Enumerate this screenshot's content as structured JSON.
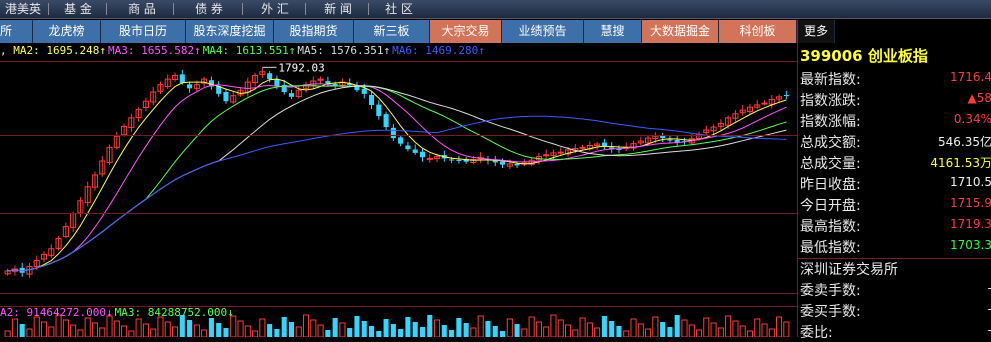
{
  "topbar": {
    "items": [
      "港美英",
      "基 金",
      "商 品",
      "债 券",
      "外 汇",
      "新 闻",
      "社 区"
    ]
  },
  "nav": {
    "tabs": [
      {
        "label": "所",
        "style": "blue"
      },
      {
        "label": "龙虎榜",
        "style": "blue"
      },
      {
        "label": "股市日历",
        "style": "blue"
      },
      {
        "label": "股东深度挖掘",
        "style": "blue"
      },
      {
        "label": "股指期货",
        "style": "blue"
      },
      {
        "label": "新三板",
        "style": "blue"
      },
      {
        "label": "大宗交易",
        "style": "hl"
      },
      {
        "label": "业绩预告",
        "style": "blue"
      },
      {
        "label": "慧搜",
        "style": "blue"
      },
      {
        "label": "大数据掘金",
        "style": "hl"
      },
      {
        "label": "科创板",
        "style": "hl"
      },
      {
        "label": "更多",
        "style": "dark"
      }
    ]
  },
  "ma_legend": [
    {
      "text": ", MA2: 1695.248↑",
      "color": "#ffff55"
    },
    {
      "text": "MA3: 1655.582↑",
      "color": "#ff55ff"
    },
    {
      "text": "MA4: 1613.551↑",
      "color": "#55ff55"
    },
    {
      "text": "MA5: 1576.351↑",
      "color": "#dddddd"
    },
    {
      "text": "MA6: 1469.280↑",
      "color": "#3b5bff"
    }
  ],
  "vol_legend": [
    {
      "text": "A2: 91464272.000↓",
      "color": "#ff55ff"
    },
    {
      "text": "MA3: 84288752.000↓",
      "color": "#55ff55"
    }
  ],
  "chart_data": {
    "type": "candlestick",
    "peak_label": "1792.03",
    "colors": {
      "up": "#ff3b3b",
      "down": "#33d6ff",
      "ma2": "#ffff55",
      "ma3": "#ff55ff",
      "ma4": "#55ff55",
      "ma5": "#dddddd",
      "ma6": "#3b5bff"
    },
    "close": [
      1240,
      1245,
      1235,
      1252,
      1268,
      1285,
      1300,
      1328,
      1360,
      1395,
      1430,
      1468,
      1500,
      1538,
      1575,
      1605,
      1632,
      1655,
      1678,
      1700,
      1725,
      1745,
      1760,
      1770,
      1750,
      1735,
      1745,
      1760,
      1740,
      1720,
      1700,
      1715,
      1730,
      1752,
      1770,
      1780,
      1760,
      1740,
      1725,
      1712,
      1730,
      1745,
      1755,
      1760,
      1748,
      1740,
      1752,
      1744,
      1730,
      1720,
      1690,
      1660,
      1630,
      1600,
      1585,
      1570,
      1560,
      1548,
      1545,
      1550,
      1545,
      1540,
      1538,
      1536,
      1542,
      1548,
      1540,
      1534,
      1528,
      1530,
      1526,
      1532,
      1540,
      1550,
      1555,
      1560,
      1562,
      1568,
      1572,
      1575,
      1580,
      1584,
      1578,
      1570,
      1568,
      1575,
      1585,
      1592,
      1600,
      1605,
      1600,
      1595,
      1588,
      1590,
      1598,
      1610,
      1622,
      1630,
      1640,
      1655,
      1666,
      1676,
      1684,
      1690,
      1695,
      1705,
      1712,
      1716
    ]
  },
  "panel": {
    "title": "399006 创业板指",
    "rows": [
      {
        "label": "最新指数:",
        "value": "1716.4",
        "color": "red"
      },
      {
        "label": "指数涨跌:",
        "value": "▲58",
        "color": "red"
      },
      {
        "label": "指数涨幅:",
        "value": "0.34%",
        "color": "red"
      },
      {
        "label": "总成交额:",
        "value": "546.35亿",
        "color": "white"
      },
      {
        "label": "总成交量:",
        "value": "4161.53万",
        "color": "yellow"
      },
      {
        "label": "昨日收盘:",
        "value": "1710.5",
        "color": "white"
      },
      {
        "label": "今日开盘:",
        "value": "1715.9",
        "color": "red"
      },
      {
        "label": "最高指数:",
        "value": "1719.3",
        "color": "red"
      },
      {
        "label": "最低指数:",
        "value": "1703.3",
        "color": "green"
      }
    ],
    "exchange": "深圳证券交易所",
    "rows2": [
      {
        "label": "委卖手数:",
        "value": "-",
        "color": "white"
      },
      {
        "label": "委买手数:",
        "value": "-",
        "color": "white"
      },
      {
        "label": "  委比:",
        "value": "-",
        "color": "white"
      }
    ]
  }
}
